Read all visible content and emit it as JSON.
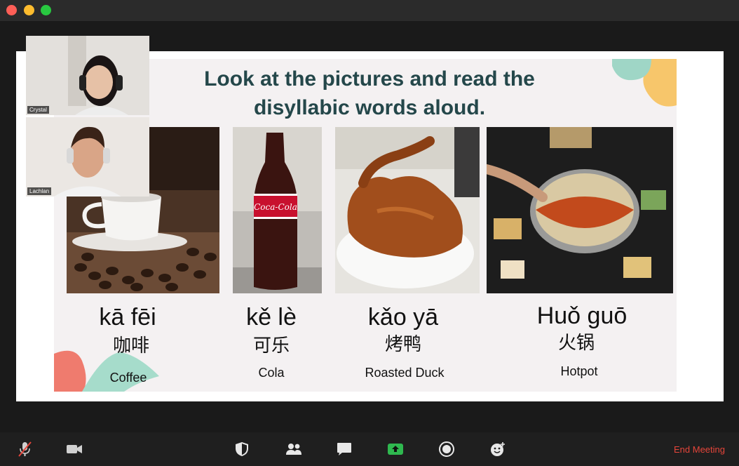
{
  "slide": {
    "title_line1": "Look at the pictures and read the",
    "title_line2": "disyllabic words aloud.",
    "items": [
      {
        "pinyin": "kā fēi",
        "hanzi": "咖啡",
        "english": "Coffee"
      },
      {
        "pinyin": "kě lè",
        "hanzi": "可乐",
        "english": "Cola"
      },
      {
        "pinyin": "kǎo yā",
        "hanzi": "烤鸭",
        "english": "Roasted Duck"
      },
      {
        "pinyin": "Huǒ guō",
        "hanzi": "火锅",
        "english": "Hotpot"
      }
    ],
    "cola_label": "Coca-Cola"
  },
  "participants": [
    {
      "name": "Crystal"
    },
    {
      "name": "Lachlan"
    }
  ],
  "toolbar": {
    "icons": [
      "mic-muted-icon",
      "video-camera-icon",
      "security-shield-icon",
      "participants-icon",
      "chat-icon",
      "share-screen-icon",
      "record-icon",
      "reactions-icon"
    ],
    "end_meeting_label": "End Meeting",
    "end_color": "#e5453a"
  },
  "colors": {
    "title": "#24474a",
    "slide_bg": "#f4f1f2",
    "toolbar_bg": "#1f1f1f",
    "share_green": "#2fb84f"
  }
}
